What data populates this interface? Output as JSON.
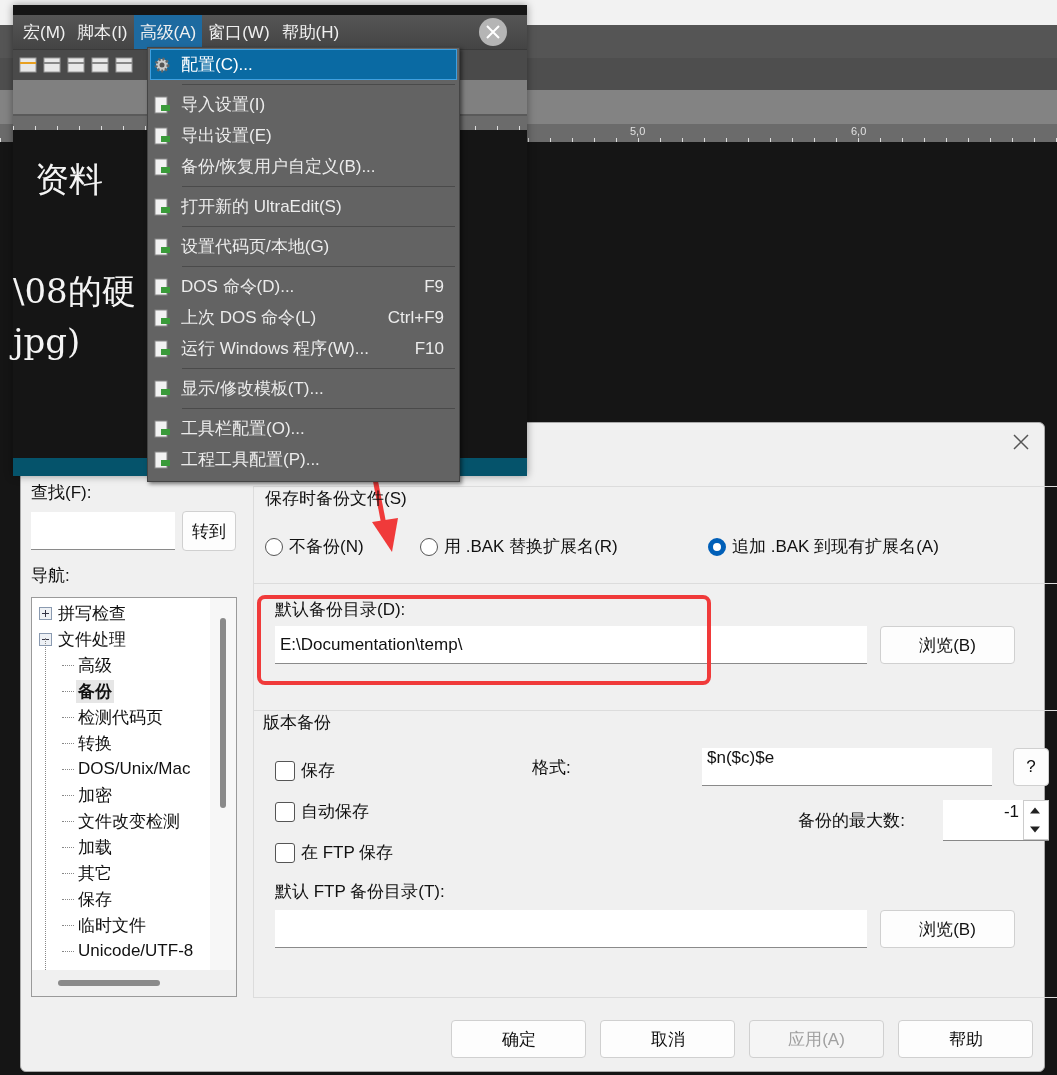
{
  "back_window": {
    "ruler_labels": [
      "5,0",
      "6,0"
    ]
  },
  "editor": {
    "menu": [
      {
        "label": "宏(M)",
        "selected": false
      },
      {
        "label": "脚本(I)",
        "selected": false
      },
      {
        "label": "高级(A)",
        "selected": true
      },
      {
        "label": "窗口(W)",
        "selected": false
      },
      {
        "label": "帮助(H)",
        "selected": false
      }
    ],
    "lines": [
      "资料",
      "\\08的硬",
      "jpg)"
    ]
  },
  "dropdown": {
    "items": [
      {
        "kind": "item",
        "label": "配置(C)...",
        "selected": true
      },
      {
        "kind": "separator"
      },
      {
        "kind": "item",
        "label": "导入设置(I)",
        "selected": false
      },
      {
        "kind": "item",
        "label": "导出设置(E)",
        "selected": false
      },
      {
        "kind": "item",
        "label": "备份/恢复用户自定义(B)...",
        "selected": false
      },
      {
        "kind": "separator"
      },
      {
        "kind": "item",
        "label": "打开新的 UltraEdit(S)",
        "selected": false
      },
      {
        "kind": "separator"
      },
      {
        "kind": "item",
        "label": "设置代码页/本地(G)",
        "selected": false
      },
      {
        "kind": "separator"
      },
      {
        "kind": "item",
        "label": "DOS 命令(D)...",
        "shortcut": "F9",
        "selected": false
      },
      {
        "kind": "item",
        "label": "上次 DOS 命令(L)",
        "shortcut": "Ctrl+F9",
        "selected": false
      },
      {
        "kind": "item",
        "label": "运行 Windows 程序(W)...",
        "shortcut": "F10",
        "selected": false
      },
      {
        "kind": "separator"
      },
      {
        "kind": "item",
        "label": "显示/修改模板(T)...",
        "selected": false
      },
      {
        "kind": "separator"
      },
      {
        "kind": "item",
        "label": "工具栏配置(O)...",
        "selected": false
      },
      {
        "kind": "item",
        "label": "工程工具配置(P)...",
        "selected": false
      }
    ]
  },
  "dialog": {
    "find": {
      "label": "查找(F):",
      "button": "转到"
    },
    "nav_label": "导航:",
    "tree": [
      {
        "label": "拼写检查",
        "expanded": false
      },
      {
        "label": "文件处理",
        "expanded": true,
        "children": [
          {
            "label": "高级",
            "selected": false
          },
          {
            "label": "备份",
            "selected": true
          },
          {
            "label": "检测代码页",
            "selected": false
          },
          {
            "label": "转换",
            "selected": false
          },
          {
            "label": "DOS/Unix/Mac",
            "selected": false
          },
          {
            "label": "加密",
            "selected": false
          },
          {
            "label": "文件改变检测",
            "selected": false
          },
          {
            "label": "加载",
            "selected": false
          },
          {
            "label": "其它",
            "selected": false
          },
          {
            "label": "保存",
            "selected": false
          },
          {
            "label": "临时文件",
            "selected": false
          },
          {
            "label": "Unicode/UTF-8",
            "selected": false
          }
        ]
      }
    ],
    "backup_group": {
      "title": "保存时备份文件(S)",
      "options": [
        {
          "label": "不备份(N)",
          "selected": false
        },
        {
          "label": "用 .BAK 替换扩展名(R)",
          "selected": false
        },
        {
          "label": "追加 .BAK 到现有扩展名(A)",
          "selected": true
        }
      ]
    },
    "backup_dir": {
      "label": "默认备份目录(D):",
      "value": "E:\\Documentation\\temp\\",
      "button": "浏览(B)"
    },
    "version": {
      "title": "版本备份",
      "checkboxes": [
        {
          "label": "保存",
          "checked": false
        },
        {
          "label": "自动保存",
          "checked": false
        },
        {
          "label": "在 FTP 保存",
          "checked": false
        }
      ],
      "format": {
        "label": "格式:",
        "value": "$n($c)$e",
        "help": "?"
      },
      "max": {
        "label": "备份的最大数:",
        "value": "-1"
      },
      "ftp_dir": {
        "label": "默认 FTP 备份目录(T):",
        "button": "浏览(B)"
      }
    },
    "buttons": [
      {
        "label": "确定",
        "disabled": false
      },
      {
        "label": "取消",
        "disabled": false
      },
      {
        "label": "应用(A)",
        "disabled": true
      },
      {
        "label": "帮助",
        "disabled": false
      }
    ]
  }
}
